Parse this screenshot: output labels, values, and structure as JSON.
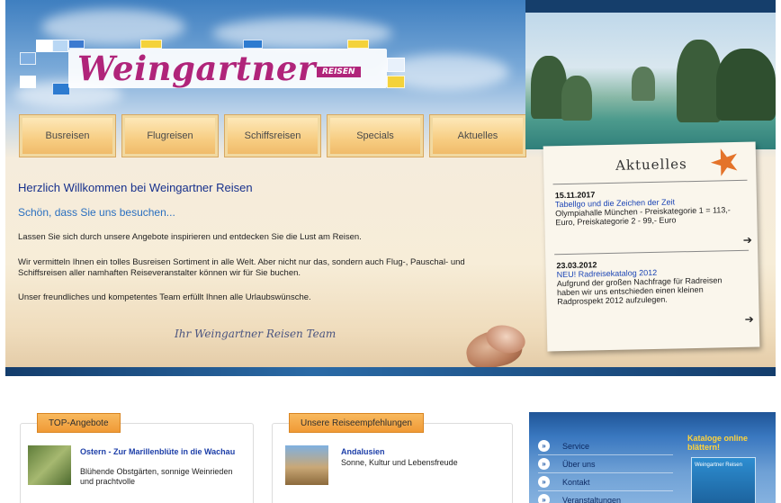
{
  "brand": {
    "name": "Weingartner",
    "suffix": "REISEN"
  },
  "nav": [
    "Busreisen",
    "Flugreisen",
    "Schiffsreisen",
    "Specials",
    "Aktuelles"
  ],
  "welcome": {
    "title": "Herzlich Willkommen bei Weingartner Reisen",
    "subtitle": "Schön, dass Sie uns besuchen...",
    "p1": "Lassen Sie sich durch unsere Angebote inspirieren und entdecken Sie die Lust am Reisen.",
    "p2": "Wir vermitteln Ihnen ein tolles Busreisen Sortiment in alle Welt. Aber nicht nur das, sondern auch Flug-, Pauschal- und Schiffsreisen aller namhaften Reiseveranstalter können wir für Sie buchen.",
    "p3": "Unser freundliches und kompetentes Team erfüllt Ihnen alle Urlaubswünsche.",
    "signature": "Ihr Weingartner Reisen Team"
  },
  "news": {
    "title": "Aktuelles",
    "items": [
      {
        "date": "15.11.2017",
        "headline": "Tabellgo und die Zeichen der Zeit",
        "text": "Olympiahalle München - Preiskategorie 1 = 113,- Euro, Preiskategorie 2 - 99,- Euro"
      },
      {
        "date": "23.03.2012",
        "headline": "NEU! Radreisekatalog 2012",
        "text": "Aufgrund der großen Nachfrage für Radreisen haben wir uns entschieden einen kleinen Radprospekt 2012 aufzulegen."
      }
    ],
    "more_icon": "arrow-right-icon"
  },
  "top_offers": {
    "tab": "TOP-Angebote",
    "headline": "Ostern - Zur Marillenblüte in die Wachau",
    "text": "Blühende Obstgärten, sonnige Weinrieden und prachtvolle"
  },
  "recommendations": {
    "tab": "Unsere Reiseempfehlungen",
    "headline": "Andalusien",
    "text": "Sonne, Kultur und Lebensfreude"
  },
  "sidebar_links": [
    "Service",
    "Über uns",
    "Kontakt",
    "Veranstaltungen"
  ],
  "catalog": {
    "line1": "Kataloge online",
    "line2": "blättern!",
    "cover": "Weingartner Reisen"
  },
  "colors": {
    "accent": "#b0247a",
    "nav_orange": "#f7cd82",
    "link_blue": "#1c45b5",
    "panel_blue": "#3a78c0"
  }
}
